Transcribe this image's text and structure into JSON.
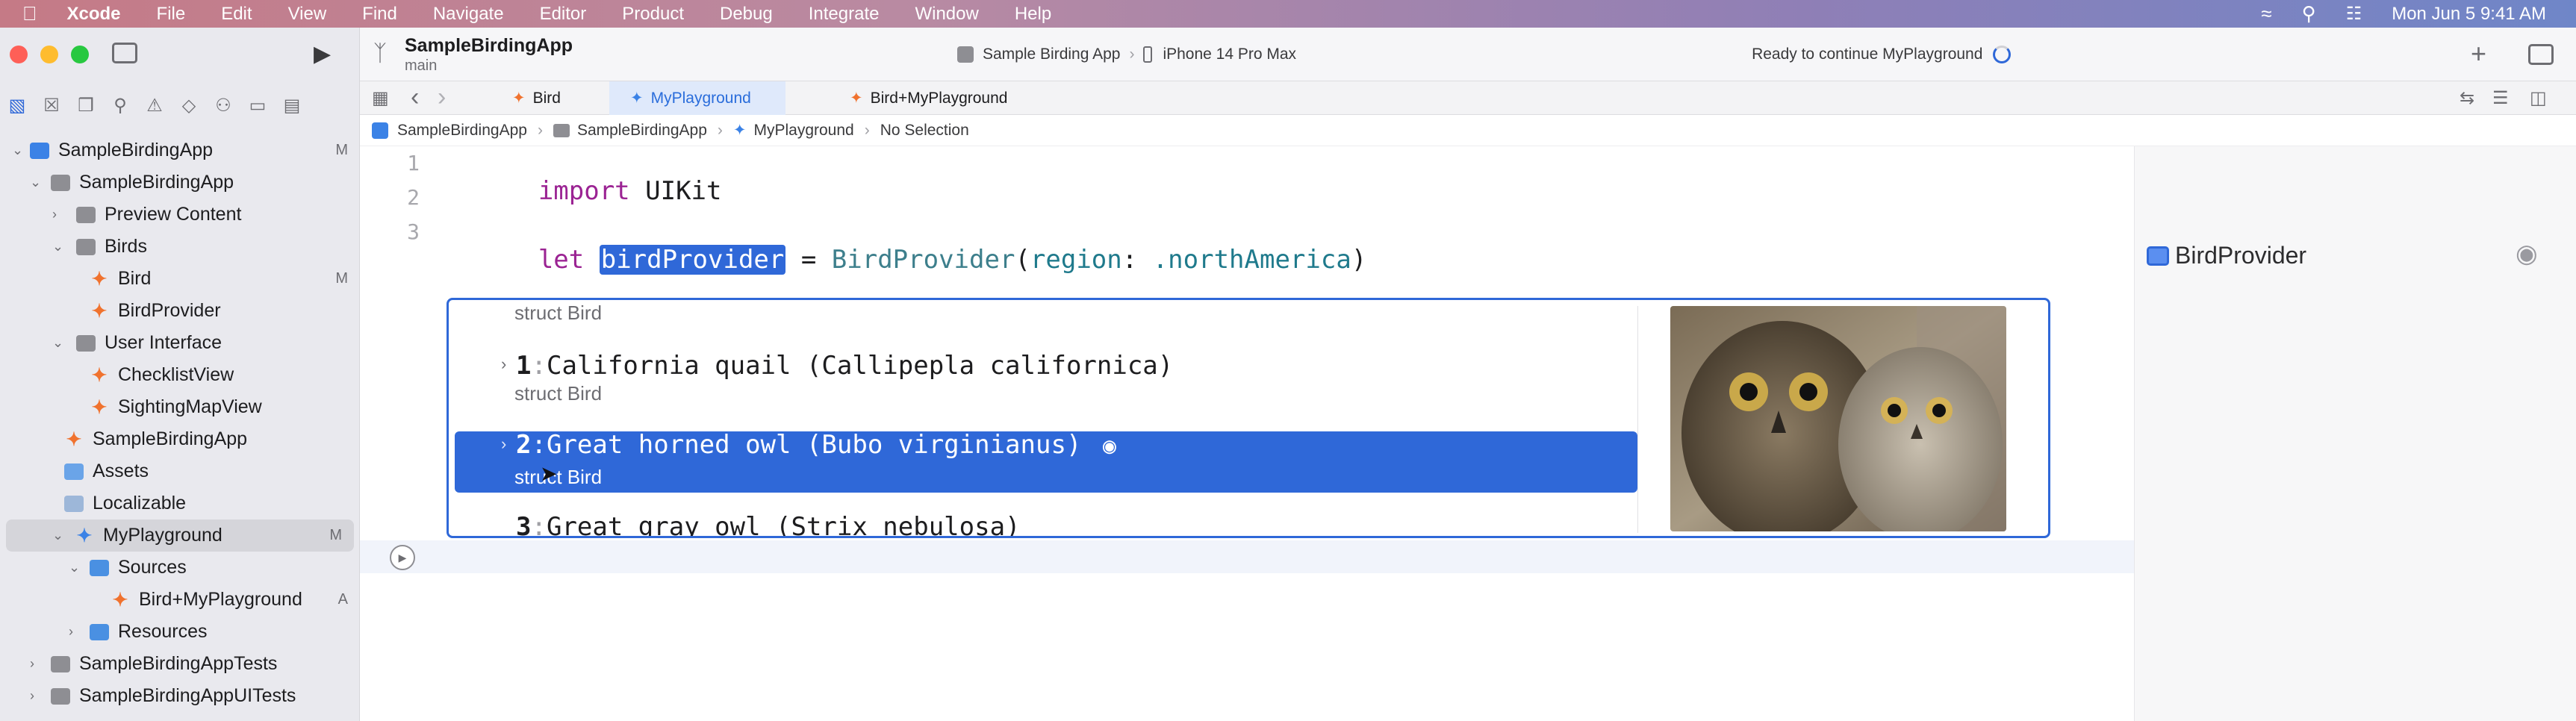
{
  "menubar": {
    "app": "Xcode",
    "items": [
      "File",
      "Edit",
      "View",
      "Find",
      "Navigate",
      "Editor",
      "Product",
      "Debug",
      "Integrate",
      "Window",
      "Help"
    ],
    "datetime": "Mon Jun 5  9:41 AM"
  },
  "toolbar": {
    "project": "SampleBirdingApp",
    "branch": "main",
    "scheme": "Sample Birding App",
    "device": "iPhone 14 Pro Max",
    "status": "Ready to continue MyPlayground"
  },
  "tabs": [
    "Bird",
    "MyPlayground",
    "Bird+MyPlayground"
  ],
  "breadcrumb": [
    "SampleBirdingApp",
    "SampleBirdingApp",
    "MyPlayground",
    "No Selection"
  ],
  "navigator": {
    "rows": [
      {
        "label": "SampleBirdingApp",
        "badge": "M"
      },
      {
        "label": "SampleBirdingApp",
        "badge": ""
      },
      {
        "label": "Preview Content",
        "badge": ""
      },
      {
        "label": "Birds",
        "badge": ""
      },
      {
        "label": "Bird",
        "badge": "M"
      },
      {
        "label": "BirdProvider",
        "badge": ""
      },
      {
        "label": "User Interface",
        "badge": ""
      },
      {
        "label": "ChecklistView",
        "badge": ""
      },
      {
        "label": "SightingMapView",
        "badge": ""
      },
      {
        "label": "SampleBirdingApp",
        "badge": ""
      },
      {
        "label": "Assets",
        "badge": ""
      },
      {
        "label": "Localizable",
        "badge": ""
      },
      {
        "label": "MyPlayground",
        "badge": "M"
      },
      {
        "label": "Sources",
        "badge": ""
      },
      {
        "label": "Bird+MyPlayground",
        "badge": "A"
      },
      {
        "label": "Resources",
        "badge": ""
      },
      {
        "label": "SampleBirdingAppTests",
        "badge": ""
      },
      {
        "label": "SampleBirdingAppUITests",
        "badge": ""
      }
    ]
  },
  "code": {
    "line_numbers": [
      "1",
      "2",
      "3"
    ],
    "line1_kw": "import",
    "line1_rest": " UIKit",
    "line3_kw": "let",
    "line3_var": "birdProvider",
    "line3_eq": " = ",
    "line3_type": "BirdProvider",
    "line3_open": "(",
    "line3_param": "region",
    "line3_colon": ": ",
    "line3_value": ".northAmerica",
    "line3_close": ")"
  },
  "result_popup": {
    "header_type": "struct Bird",
    "items": [
      {
        "index": "1",
        "name": "California quail (Callipepla californica)",
        "type": "struct Bird"
      },
      {
        "index": "2",
        "name": "Great horned owl (Bubo virginianus)",
        "type": "struct Bird"
      },
      {
        "index": "3",
        "name": "Great gray owl (Strix nebulosa)",
        "type": ""
      }
    ],
    "selected_index": 2
  },
  "canvas": {
    "result_label": "BirdProvider"
  },
  "colors": {
    "accent": "#2f68d8",
    "keyword": "#9b2393",
    "type": "#3d7f8c"
  }
}
